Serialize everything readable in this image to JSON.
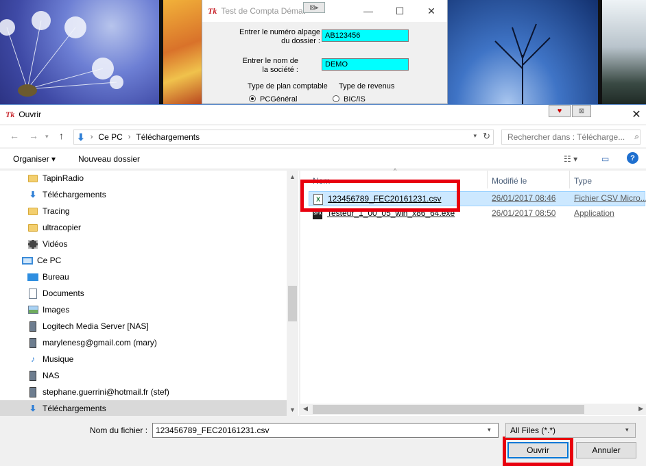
{
  "back_window": {
    "title": "Test de Compta Démat",
    "label_dossier_1": "Entrer le numéro alpage",
    "label_dossier_2": "du dossier :",
    "value_dossier": "AB123456",
    "label_societe_1": "Entrer le nom de",
    "label_societe_2": "la société :",
    "value_societe": "DEMO",
    "plan_title": "Type de plan comptable",
    "plan_option": "PCGénéral",
    "revenus_title": "Type de revenus",
    "revenus_option": "BIC/IS"
  },
  "dialog": {
    "title": "Ouvrir",
    "close_glyph": "✕",
    "breadcrumb": [
      "Ce PC",
      "Téléchargements"
    ],
    "search_placeholder": "Rechercher dans : Télécharge...",
    "toolbar": {
      "organize": "Organiser ▾",
      "new_folder": "Nouveau dossier"
    },
    "tree": [
      {
        "label": "TapinRadio",
        "icon": "folder-icon"
      },
      {
        "label": "Téléchargements",
        "icon": "download-icon"
      },
      {
        "label": "Tracing",
        "icon": "folder-icon"
      },
      {
        "label": "ultracopier",
        "icon": "folder-icon"
      },
      {
        "label": "Vidéos",
        "icon": "video-icon"
      },
      {
        "label": "Ce PC",
        "icon": "pc-icon"
      },
      {
        "label": "Bureau",
        "icon": "desktop-icon"
      },
      {
        "label": "Documents",
        "icon": "documents-icon"
      },
      {
        "label": "Images",
        "icon": "images-icon"
      },
      {
        "label": "Logitech Media Server [NAS]",
        "icon": "network-drive-icon"
      },
      {
        "label": "marylenesg@gmail.com (mary)",
        "icon": "network-drive-icon"
      },
      {
        "label": "Musique",
        "icon": "music-icon"
      },
      {
        "label": "NAS",
        "icon": "network-drive-icon"
      },
      {
        "label": "stephane.guerrini@hotmail.fr (stef)",
        "icon": "network-drive-icon"
      },
      {
        "label": "Téléchargements",
        "icon": "download-icon"
      }
    ],
    "columns": {
      "name": "Nom",
      "modified": "Modifié le",
      "type": "Type"
    },
    "files": [
      {
        "name": "123456789_FEC20161231.csv",
        "modified": "26/01/2017 08:46",
        "type": "Fichier CSV Micro...",
        "icon": "excel-csv-icon"
      },
      {
        "name": "Testeur_1_00_05_win_x86_64.exe",
        "modified": "26/01/2017 08:50",
        "type": "Application",
        "icon": "sfx-exe-icon"
      }
    ],
    "filename_label": "Nom du fichier :",
    "filename_value": "123456789_FEC20161231.csv",
    "filter_value": "All Files (*.*)",
    "open_button": "Ouvrir",
    "cancel_button": "Annuler"
  },
  "colors": {
    "highlight_box": "#e8000e",
    "selected_row": "#cce8ff",
    "input_cyan": "#00ffff",
    "accent": "#0078d7"
  }
}
